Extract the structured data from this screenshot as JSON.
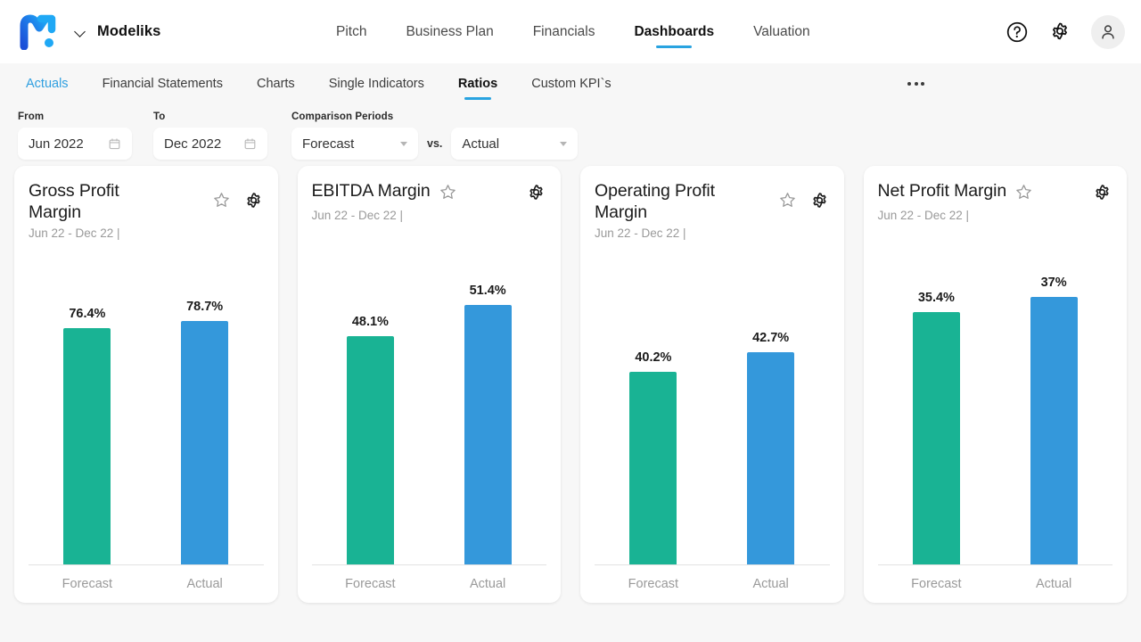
{
  "header": {
    "logo_icon": "modeliks-m-logo",
    "brand_name": "Modeliks",
    "brand_chevron_icon": "chevron-down-icon",
    "nav": [
      {
        "label": "Pitch",
        "active": false
      },
      {
        "label": "Business Plan",
        "active": false
      },
      {
        "label": "Financials",
        "active": false
      },
      {
        "label": "Dashboards",
        "active": true
      },
      {
        "label": "Valuation",
        "active": false
      }
    ],
    "help_icon": "question-circle-icon",
    "settings_icon": "gear-icon",
    "avatar_icon": "user-avatar-icon"
  },
  "subnav": {
    "items": [
      {
        "label": "Actuals",
        "style": "blue"
      },
      {
        "label": "Financial Statements",
        "style": "normal"
      },
      {
        "label": "Charts",
        "style": "normal"
      },
      {
        "label": "Single Indicators",
        "style": "normal"
      },
      {
        "label": "Ratios",
        "style": "active"
      },
      {
        "label": "Custom KPI`s",
        "style": "normal"
      }
    ],
    "overflow_icon": "ellipsis-horizontal-icon"
  },
  "filters": {
    "from_label": "From",
    "from_value": "Jun 2022",
    "from_icon": "calendar-icon",
    "to_label": "To",
    "to_value": "Dec 2022",
    "to_icon": "calendar-icon",
    "comparison_label": "Comparison Periods",
    "comparison_a": "Forecast",
    "vs_label": "vs.",
    "comparison_b": "Actual",
    "dropdown_icon": "chevron-down-icon"
  },
  "colors": {
    "forecast": "#19b394",
    "actual": "#3498db",
    "accent": "#29a3e0",
    "page_bg": "#f7f7f7",
    "card_bg": "#ffffff"
  },
  "cards": [
    {
      "title": "Gross Profit Margin",
      "subtitle": "Jun 22 - Dec 22 |",
      "star_icon": "star-outline-icon",
      "gear_icon": "gear-icon",
      "title_wraps": true
    },
    {
      "title": "EBITDA Margin",
      "subtitle": "Jun 22 - Dec 22 |",
      "star_icon": "star-outline-icon",
      "gear_icon": "gear-icon",
      "title_wraps": false
    },
    {
      "title": "Operating Profit Margin",
      "subtitle": "Jun 22 - Dec 22 |",
      "star_icon": "star-outline-icon",
      "gear_icon": "gear-icon",
      "title_wraps": true
    },
    {
      "title": "Net Profit Margin",
      "subtitle": "Jun 22 - Dec 22 |",
      "star_icon": "star-outline-icon",
      "gear_icon": "gear-icon",
      "title_wraps": false
    }
  ],
  "chart_data": [
    {
      "type": "bar",
      "title": "Gross Profit Margin",
      "subtitle": "Jun 22 - Dec 22",
      "categories": [
        "Forecast",
        "Actual"
      ],
      "values": [
        76.4,
        78.7
      ],
      "labels": [
        "76.4%",
        "78.7%"
      ],
      "colors": [
        "#19b394",
        "#3498db"
      ],
      "xlabel": "",
      "ylabel": "",
      "ylim": [
        0,
        100
      ],
      "grid": false,
      "legend": false
    },
    {
      "type": "bar",
      "title": "EBITDA Margin",
      "subtitle": "Jun 22 - Dec 22",
      "categories": [
        "Forecast",
        "Actual"
      ],
      "values": [
        48.1,
        51.4
      ],
      "labels": [
        "48.1%",
        "51.4%"
      ],
      "colors": [
        "#19b394",
        "#3498db"
      ],
      "xlabel": "",
      "ylabel": "",
      "ylim": [
        0,
        100
      ],
      "grid": false,
      "legend": false
    },
    {
      "type": "bar",
      "title": "Operating Profit Margin",
      "subtitle": "Jun 22 - Dec 22",
      "categories": [
        "Forecast",
        "Actual"
      ],
      "values": [
        40.2,
        42.7
      ],
      "labels": [
        "40.2%",
        "42.7%"
      ],
      "colors": [
        "#19b394",
        "#3498db"
      ],
      "xlabel": "",
      "ylabel": "",
      "ylim": [
        0,
        100
      ],
      "grid": false,
      "legend": false
    },
    {
      "type": "bar",
      "title": "Net Profit Margin",
      "subtitle": "Jun 22 - Dec 22",
      "categories": [
        "Forecast",
        "Actual"
      ],
      "values": [
        35.4,
        37.0
      ],
      "labels": [
        "35.4%",
        "37%"
      ],
      "colors": [
        "#19b394",
        "#3498db"
      ],
      "xlabel": "",
      "ylabel": "",
      "ylim": [
        0,
        100
      ],
      "grid": false,
      "legend": false
    }
  ]
}
